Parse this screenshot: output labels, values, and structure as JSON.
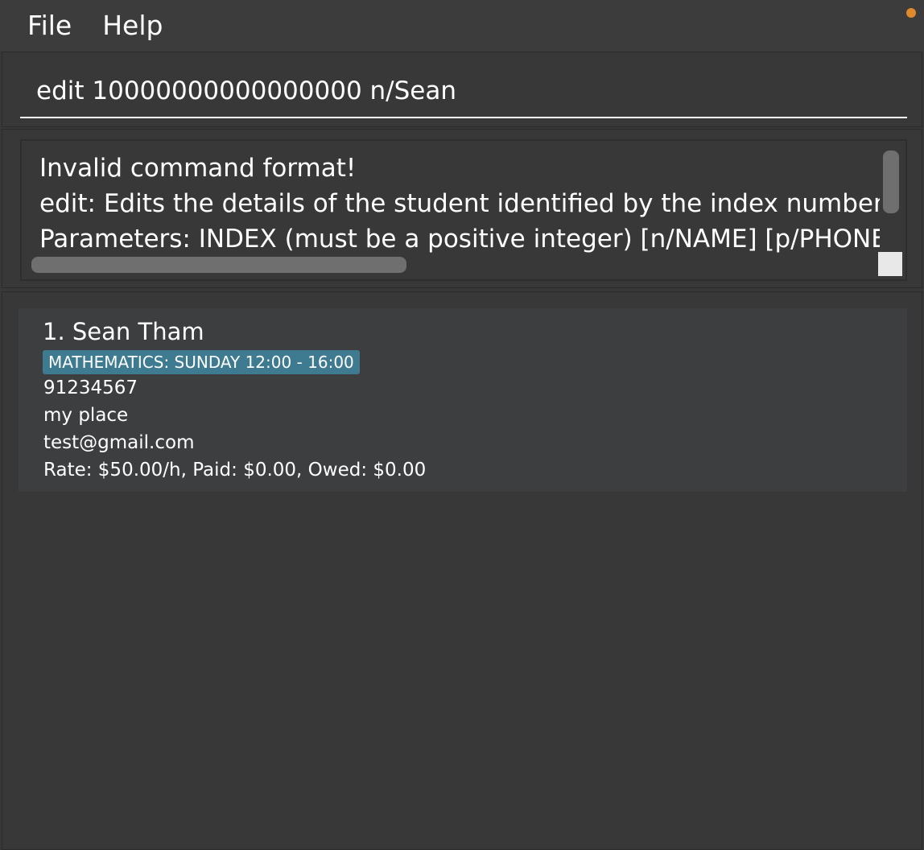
{
  "menubar": {
    "items": [
      {
        "label": "File"
      },
      {
        "label": "Help"
      }
    ],
    "status_dot_color": "#e08a2e"
  },
  "command_box": {
    "value": "edit 10000000000000000 n/Sean"
  },
  "result_display": {
    "lines": [
      "Invalid command format!",
      "edit: Edits the details of the student identified by the index number used i",
      "Parameters: INDEX (must be a positive integer) [n/NAME] [p/PHONE] [e/"
    ]
  },
  "person_list": {
    "persons": [
      {
        "name": "1. Sean Tham",
        "tag": "MATHEMATICS: SUNDAY 12:00 - 16:00",
        "tag_color": "#3e7b91",
        "phone": "91234567",
        "address": "my place",
        "email": "test@gmail.com",
        "payment": "Rate: $50.00/h, Paid: $0.00, Owed: $0.00"
      }
    ]
  }
}
